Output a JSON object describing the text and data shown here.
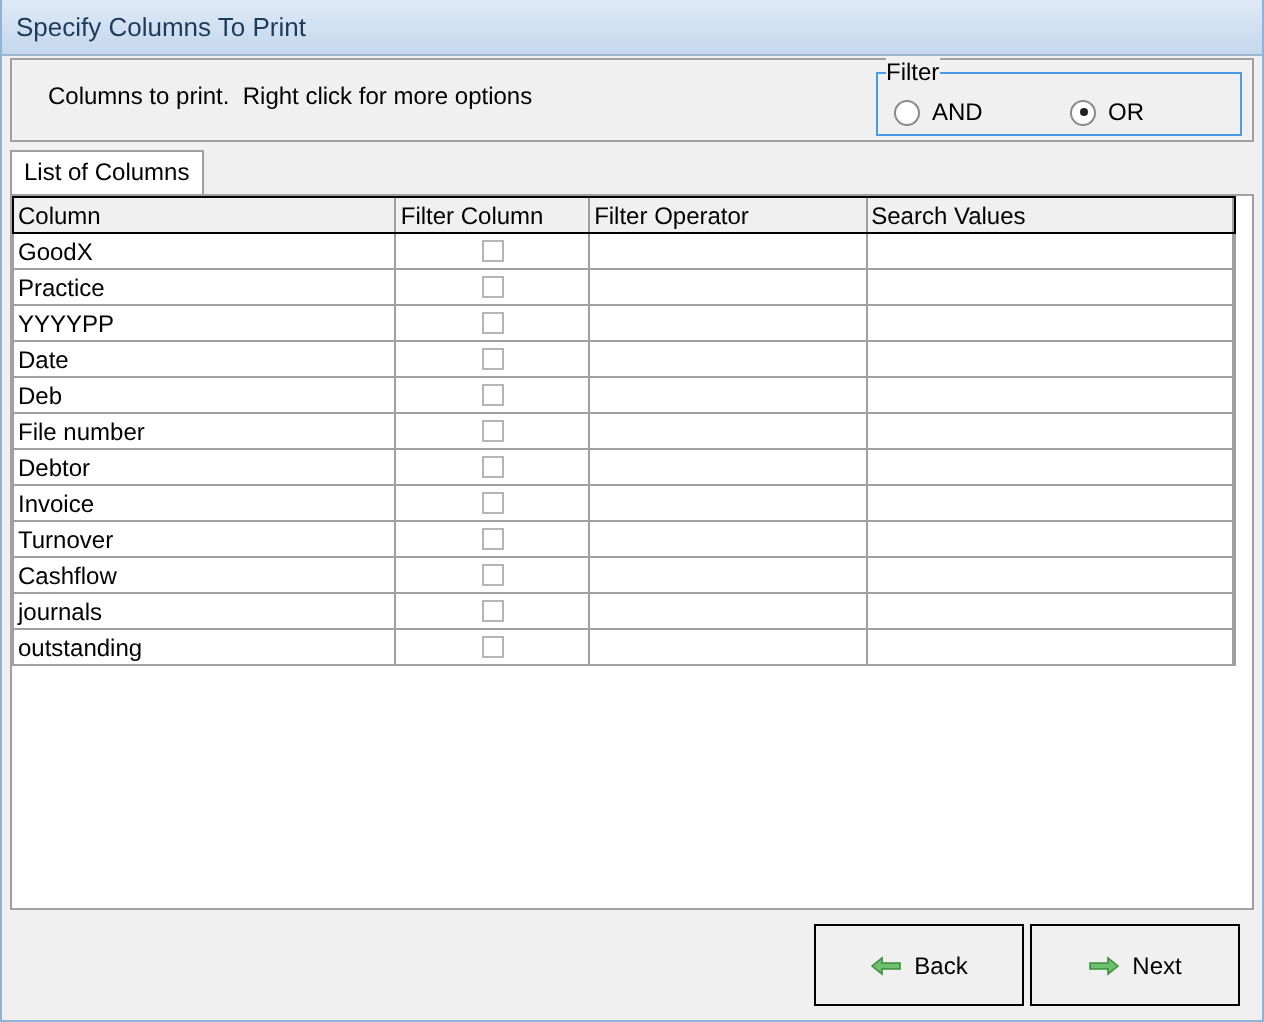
{
  "window": {
    "title": "Specify Columns To Print"
  },
  "instructions": "Columns to print.  Right click for more options",
  "filter": {
    "legend": "Filter",
    "options": [
      {
        "label": "AND",
        "selected": false
      },
      {
        "label": "OR",
        "selected": true
      }
    ]
  },
  "tabs": [
    {
      "label": "List of Columns",
      "selected": true
    }
  ],
  "table": {
    "columns": [
      "Column",
      "Filter Column",
      "Filter Operator",
      "Search Values"
    ],
    "rows": [
      {
        "column": "GoodX",
        "checked": false
      },
      {
        "column": "Practice",
        "checked": false
      },
      {
        "column": "YYYYPP",
        "checked": false
      },
      {
        "column": "Date",
        "checked": false
      },
      {
        "column": "Deb",
        "checked": false
      },
      {
        "column": "File number",
        "checked": false
      },
      {
        "column": "Debtor",
        "checked": false
      },
      {
        "column": "Invoice",
        "checked": false
      },
      {
        "column": "Turnover",
        "checked": false
      },
      {
        "column": "Cashflow",
        "checked": false
      },
      {
        "column": "journals",
        "checked": false
      },
      {
        "column": "outstanding",
        "checked": false
      }
    ]
  },
  "buttons": [
    {
      "kind": "back",
      "label": "Back"
    },
    {
      "kind": "next",
      "label": "Next"
    }
  ]
}
